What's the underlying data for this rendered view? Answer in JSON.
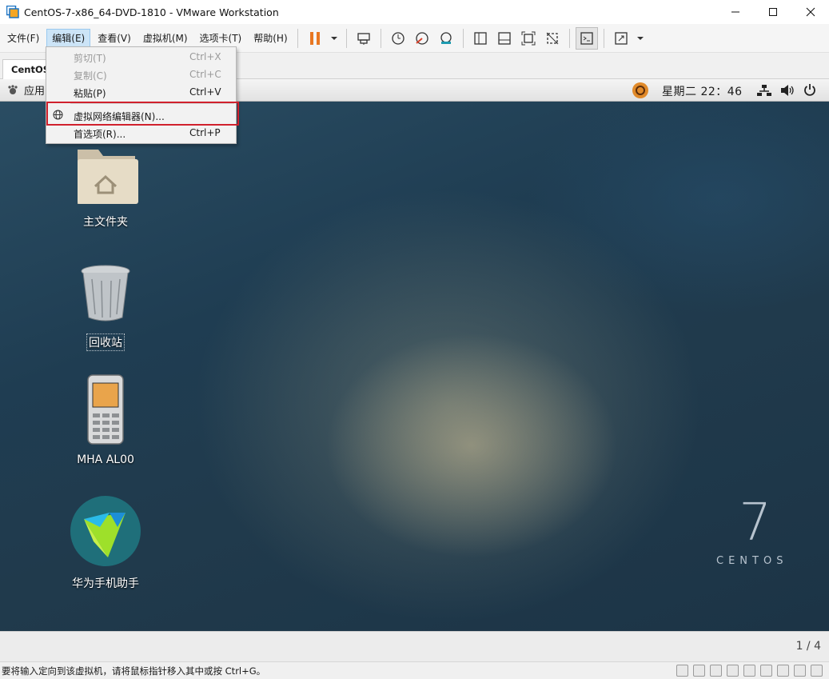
{
  "window": {
    "title": "CentOS-7-x86_64-DVD-1810 - VMware Workstation",
    "controls": [
      "minimize",
      "maximize",
      "close"
    ]
  },
  "menubar": {
    "items": [
      {
        "label": "文件(F)"
      },
      {
        "label": "编辑(E)",
        "active": true
      },
      {
        "label": "查看(V)"
      },
      {
        "label": "虚拟机(M)"
      },
      {
        "label": "选项卡(T)"
      },
      {
        "label": "帮助(H)"
      }
    ]
  },
  "toolbar": {
    "icons": [
      "pause-icon",
      "dropdown-arrow-icon",
      "send-ctrl-alt-del-icon",
      "snapshot-icon",
      "revert-snapshot-icon",
      "snapshot-manager-icon",
      "show-library-icon",
      "show-thumbnail-icon",
      "full-screen-icon",
      "unity-icon",
      "console-view-icon",
      "stretch-icon"
    ],
    "accent": "#e87722"
  },
  "tab": {
    "label": "CentOS"
  },
  "guest_panel": {
    "apps_label": "应用",
    "clock": "星期二 22：46"
  },
  "edit_menu": {
    "items": [
      {
        "label": "剪切(T)",
        "shortcut": "Ctrl+X",
        "enabled": false
      },
      {
        "label": "复制(C)",
        "shortcut": "Ctrl+C",
        "enabled": false
      },
      {
        "label": "粘贴(P)",
        "shortcut": "Ctrl+V",
        "enabled": true
      },
      {
        "label": "虚拟网络编辑器(N)...",
        "shortcut": "",
        "enabled": true,
        "highlighted": true
      },
      {
        "label": "首选项(R)...",
        "shortcut": "Ctrl+P",
        "enabled": true
      }
    ],
    "highlight_color": "#d0212d"
  },
  "desktop": {
    "icons": [
      {
        "label": "主文件夹",
        "icon": "home-folder-icon"
      },
      {
        "label": "回收站",
        "icon": "trash-icon"
      },
      {
        "label": "MHA AL00",
        "icon": "phone-icon"
      },
      {
        "label": "华为手机助手",
        "icon": "hisuite-icon"
      }
    ],
    "brand_number": "7",
    "brand_word": "CENTOS"
  },
  "guest_bottom": {
    "pager": "1 / 4"
  },
  "statusbar": {
    "message": "要将输入定向到该虚拟机，请将鼠标指针移入其中或按 Ctrl+G。"
  }
}
